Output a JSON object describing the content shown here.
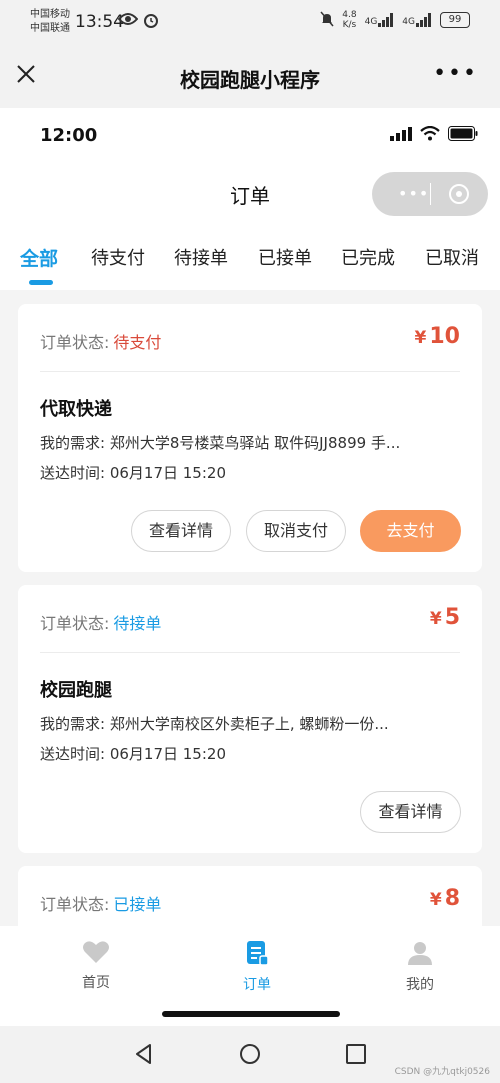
{
  "phone_status": {
    "carrier_1": "中国移动",
    "carrier_2": "中国联通",
    "time": "13:54",
    "net_speed": "4.8",
    "net_speed_unit": "K/s",
    "signal_1": "4G",
    "signal_2": "4G",
    "battery": "99"
  },
  "mini_program": {
    "title": "校园跑腿小程序"
  },
  "inner_status": {
    "time": "12:00"
  },
  "nav": {
    "title": "订单"
  },
  "tabs": [
    {
      "label": "全部",
      "active": true
    },
    {
      "label": "待支付",
      "active": false
    },
    {
      "label": "待接单",
      "active": false
    },
    {
      "label": "已接单",
      "active": false
    },
    {
      "label": "已完成",
      "active": false
    },
    {
      "label": "已取消",
      "active": false
    }
  ],
  "orders": [
    {
      "status_label": "订单状态:",
      "status": "待支付",
      "status_color": "#d94a3a",
      "currency": "¥",
      "price": "10",
      "type": "代取快递",
      "requirement": "我的需求: 郑州大学8号楼菜鸟驿站 取件码JJ8899 手...",
      "delivery_time": "送达时间: 06月17日 15:20",
      "buttons": [
        "查看详情",
        "取消支付",
        "去支付"
      ]
    },
    {
      "status_label": "订单状态:",
      "status": "待接单",
      "status_color": "#1a9be3",
      "currency": "¥",
      "price": "5",
      "type": "校园跑腿",
      "requirement": "我的需求: 郑州大学南校区外卖柜子上, 螺蛳粉一份...",
      "delivery_time": "送达时间: 06月17日 15:20",
      "buttons": [
        "查看详情"
      ]
    },
    {
      "status_label": "订单状态:",
      "status": "已接单",
      "status_color": "#1a9be3",
      "currency": "¥",
      "price": "8"
    }
  ],
  "tabbar": [
    {
      "label": "首页",
      "icon": "heart-icon",
      "active": false
    },
    {
      "label": "订单",
      "icon": "order-icon",
      "active": true
    },
    {
      "label": "我的",
      "icon": "person-icon",
      "active": false
    }
  ],
  "watermark": "CSDN @九九qtkj0526",
  "colors": {
    "accent": "#1a9be3",
    "price": "#e0533a",
    "pay_button": "#f99a5f"
  }
}
